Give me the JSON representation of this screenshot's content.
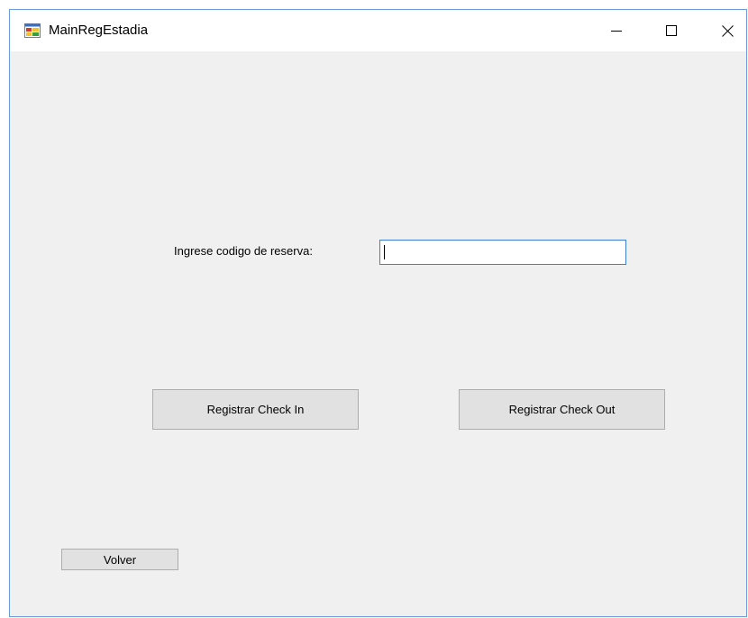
{
  "window": {
    "title": "MainRegEstadia",
    "app_icon": "winforms-app-icon",
    "controls": {
      "minimize_icon": "minimize-icon",
      "maximize_icon": "maximize-icon",
      "close_icon": "close-icon"
    }
  },
  "form": {
    "reservation_label": "Ingrese codigo de reserva:",
    "reservation_input_value": "",
    "checkin_label": "Registrar Check In",
    "checkout_label": "Registrar Check Out",
    "back_label": "Volver"
  },
  "colors": {
    "form_background": "#f0f0f0",
    "titlebar_background": "#ffffff",
    "window_border": "#6b9bd8",
    "input_focus_border": "#3c7fd4",
    "button_background": "#e1e1e1",
    "button_border": "#adadad"
  }
}
